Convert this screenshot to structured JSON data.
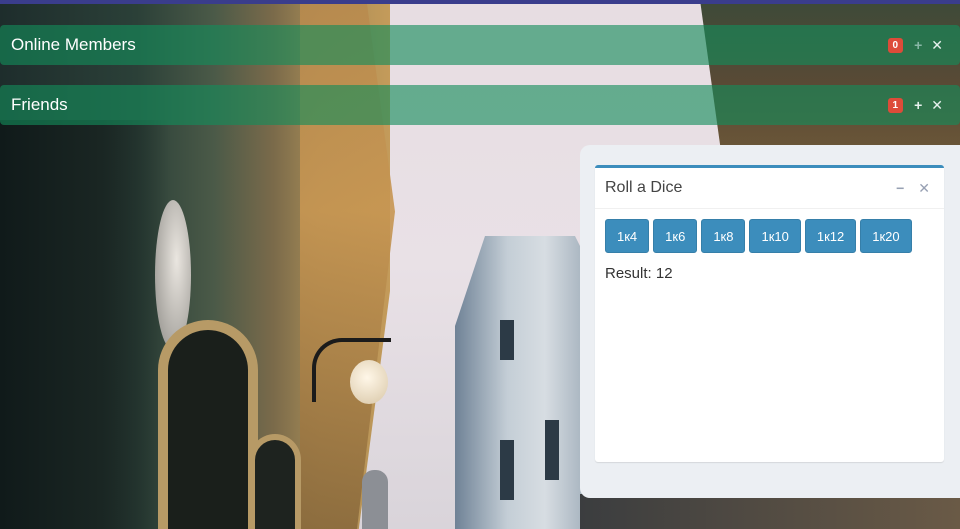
{
  "panels": {
    "online_members": {
      "title": "Online Members",
      "badge": "0"
    },
    "friends": {
      "title": "Friends",
      "badge": "1"
    }
  },
  "dice": {
    "title": "Roll a Dice",
    "buttons": [
      "1к4",
      "1к6",
      "1к8",
      "1к10",
      "1к12",
      "1к20"
    ],
    "result_label": "Result:",
    "result_value": "12"
  },
  "icons": {
    "add": "plus-icon",
    "close": "close-icon",
    "minimize": "minus-icon"
  },
  "colors": {
    "panel_bg": "#148c5a",
    "badge": "#dd4b39",
    "primary": "#3c8dbc",
    "top_strip": "#3a3d8c"
  }
}
